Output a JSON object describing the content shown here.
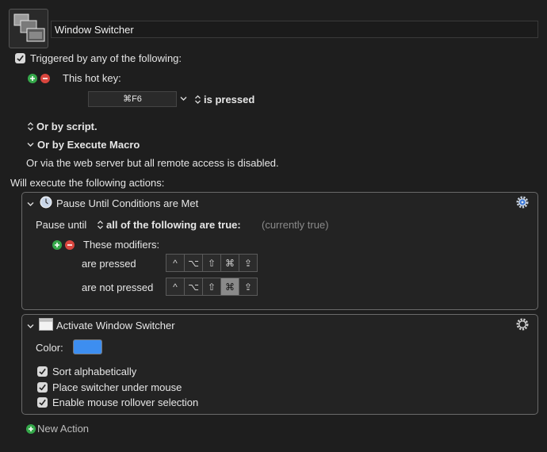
{
  "macro": {
    "name": "Window Switcher",
    "trigger_header": "Triggered by any of the following:",
    "hotkey_label": "This hot key:",
    "hotkey_value": "⌘F6",
    "hotkey_state": "is pressed",
    "or_script": "Or by script.",
    "or_execute": "Or by Execute Macro",
    "web_server": "Or via the web server but all remote access is disabled.",
    "will_execute": "Will execute the following actions:"
  },
  "action1": {
    "title": "Pause Until Conditions are Met",
    "pause_until": "Pause until",
    "condition": "all of the following are true:",
    "status": "(currently true)",
    "modifiers_label": "These modifiers:",
    "are_pressed": "are pressed",
    "are_not_pressed": "are not pressed",
    "modifier_keys": [
      "^",
      "⌥",
      "⇧",
      "⌘",
      "⇪"
    ]
  },
  "action2": {
    "title": "Activate Window Switcher",
    "color_label": "Color:",
    "color_value": "#3d8ef0",
    "options": [
      "Sort alphabetically",
      "Place switcher under mouse",
      "Enable mouse rollover selection"
    ]
  },
  "footer": {
    "new_action": "New Action"
  }
}
